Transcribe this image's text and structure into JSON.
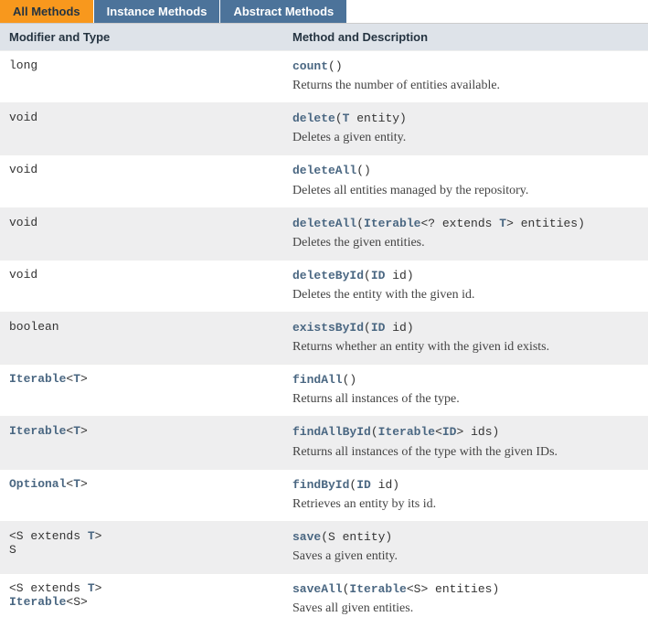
{
  "tabs": [
    {
      "label": "All Methods",
      "active": true
    },
    {
      "label": "Instance Methods",
      "active": false
    },
    {
      "label": "Abstract Methods",
      "active": false
    }
  ],
  "headers": {
    "type": "Modifier and Type",
    "desc": "Method and Description"
  },
  "rows": [
    {
      "type": [
        {
          "t": "long",
          "link": false
        }
      ],
      "sig": [
        {
          "t": "count",
          "link": true
        },
        {
          "t": "()",
          "link": false
        }
      ],
      "desc": "Returns the number of entities available."
    },
    {
      "type": [
        {
          "t": "void",
          "link": false
        }
      ],
      "sig": [
        {
          "t": "delete",
          "link": true
        },
        {
          "t": "(",
          "link": false
        },
        {
          "t": "T",
          "link": true
        },
        {
          "t": " entity)",
          "link": false
        }
      ],
      "desc": "Deletes a given entity."
    },
    {
      "type": [
        {
          "t": "void",
          "link": false
        }
      ],
      "sig": [
        {
          "t": "deleteAll",
          "link": true
        },
        {
          "t": "()",
          "link": false
        }
      ],
      "desc": "Deletes all entities managed by the repository."
    },
    {
      "type": [
        {
          "t": "void",
          "link": false
        }
      ],
      "sig": [
        {
          "t": "deleteAll",
          "link": true
        },
        {
          "t": "(",
          "link": false
        },
        {
          "t": "Iterable",
          "link": true
        },
        {
          "t": "<? extends ",
          "link": false
        },
        {
          "t": "T",
          "link": true
        },
        {
          "t": "> entities)",
          "link": false
        }
      ],
      "desc": "Deletes the given entities."
    },
    {
      "type": [
        {
          "t": "void",
          "link": false
        }
      ],
      "sig": [
        {
          "t": "deleteById",
          "link": true
        },
        {
          "t": "(",
          "link": false
        },
        {
          "t": "ID",
          "link": true
        },
        {
          "t": " id)",
          "link": false
        }
      ],
      "desc": "Deletes the entity with the given id."
    },
    {
      "type": [
        {
          "t": "boolean",
          "link": false
        }
      ],
      "sig": [
        {
          "t": "existsById",
          "link": true
        },
        {
          "t": "(",
          "link": false
        },
        {
          "t": "ID",
          "link": true
        },
        {
          "t": " id)",
          "link": false
        }
      ],
      "desc": "Returns whether an entity with the given id exists."
    },
    {
      "type": [
        {
          "t": "Iterable",
          "link": true
        },
        {
          "t": "<",
          "link": false
        },
        {
          "t": "T",
          "link": true
        },
        {
          "t": ">",
          "link": false
        }
      ],
      "sig": [
        {
          "t": "findAll",
          "link": true
        },
        {
          "t": "()",
          "link": false
        }
      ],
      "desc": "Returns all instances of the type."
    },
    {
      "type": [
        {
          "t": "Iterable",
          "link": true
        },
        {
          "t": "<",
          "link": false
        },
        {
          "t": "T",
          "link": true
        },
        {
          "t": ">",
          "link": false
        }
      ],
      "sig": [
        {
          "t": "findAllById",
          "link": true
        },
        {
          "t": "(",
          "link": false
        },
        {
          "t": "Iterable",
          "link": true
        },
        {
          "t": "<",
          "link": false
        },
        {
          "t": "ID",
          "link": true
        },
        {
          "t": "> ids)",
          "link": false
        }
      ],
      "desc": "Returns all instances of the type with the given IDs."
    },
    {
      "type": [
        {
          "t": "Optional",
          "link": true
        },
        {
          "t": "<",
          "link": false
        },
        {
          "t": "T",
          "link": true
        },
        {
          "t": ">",
          "link": false
        }
      ],
      "sig": [
        {
          "t": "findById",
          "link": true
        },
        {
          "t": "(",
          "link": false
        },
        {
          "t": "ID",
          "link": true
        },
        {
          "t": " id)",
          "link": false
        }
      ],
      "desc": "Retrieves an entity by its id."
    },
    {
      "type": [
        {
          "t": "<S extends ",
          "link": false
        },
        {
          "t": "T",
          "link": true
        },
        {
          "t": ">",
          "link": false
        },
        {
          "t": "\n",
          "link": false,
          "br": true
        },
        {
          "t": "S",
          "link": false
        }
      ],
      "sig": [
        {
          "t": "save",
          "link": true
        },
        {
          "t": "(S entity)",
          "link": false
        }
      ],
      "desc": "Saves a given entity."
    },
    {
      "type": [
        {
          "t": "<S extends ",
          "link": false
        },
        {
          "t": "T",
          "link": true
        },
        {
          "t": ">",
          "link": false
        },
        {
          "t": "\n",
          "link": false,
          "br": true
        },
        {
          "t": "Iterable",
          "link": true
        },
        {
          "t": "<S>",
          "link": false
        }
      ],
      "sig": [
        {
          "t": "saveAll",
          "link": true
        },
        {
          "t": "(",
          "link": false
        },
        {
          "t": "Iterable",
          "link": true
        },
        {
          "t": "<S> entities)",
          "link": false
        }
      ],
      "desc": "Saves all given entities."
    }
  ]
}
